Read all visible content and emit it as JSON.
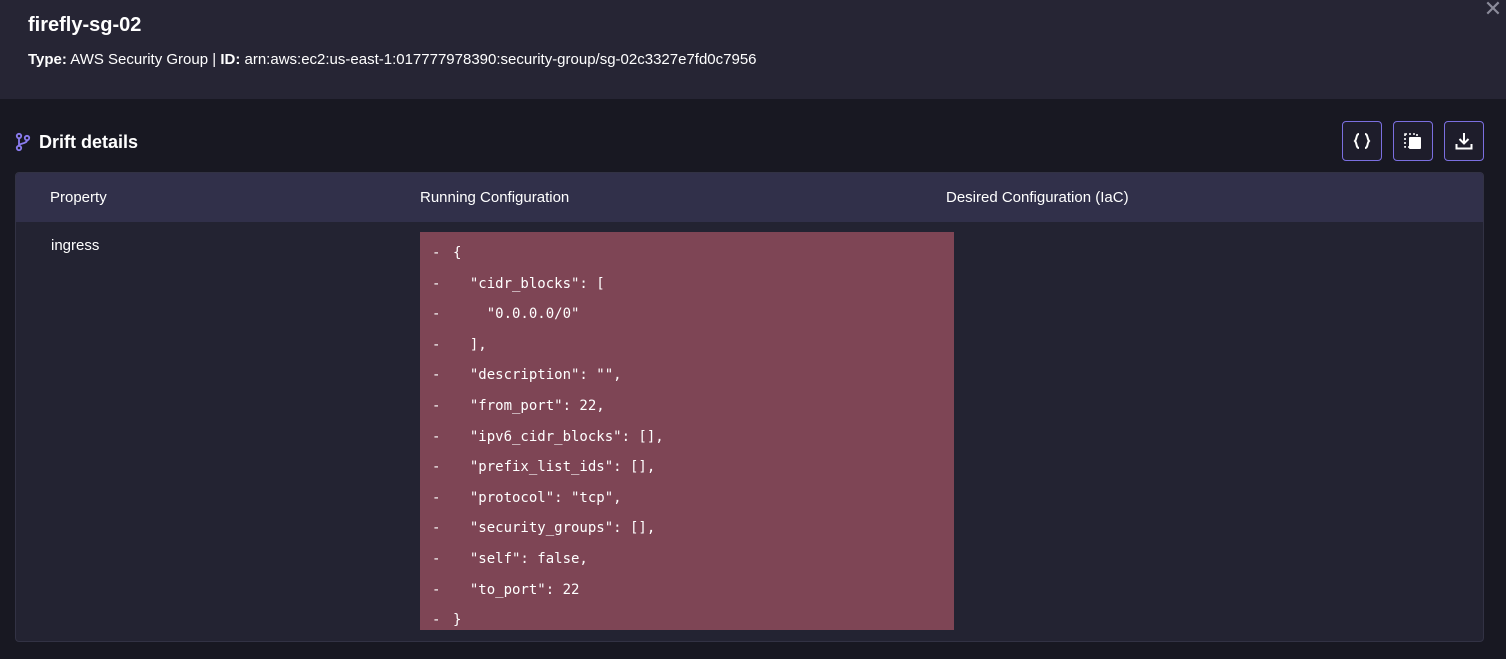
{
  "header": {
    "title": "firefly-sg-02",
    "type_label": "Type:",
    "type_value": "AWS Security Group",
    "separator": "|",
    "id_label": "ID:",
    "id_value": "arn:aws:ec2:us-east-1:017777978390:security-group/sg-02c3327e7fd0c7956",
    "close_icon": "close-icon"
  },
  "section": {
    "title": "Drift details",
    "icon": "git-branch-icon"
  },
  "toolbar": {
    "buttons": [
      {
        "icon": "code-braces-icon"
      },
      {
        "icon": "copy-icon"
      },
      {
        "icon": "download-icon"
      }
    ]
  },
  "table": {
    "columns": [
      "Property",
      "Running Configuration",
      "Desired Configuration (IaC)"
    ],
    "rows": [
      {
        "property": "ingress",
        "running": [
          {
            "marker": "-",
            "text": "{"
          },
          {
            "marker": "-",
            "text": "  \"cidr_blocks\": ["
          },
          {
            "marker": "-",
            "text": "    \"0.0.0.0/0\""
          },
          {
            "marker": "-",
            "text": "  ],"
          },
          {
            "marker": "-",
            "text": "  \"description\": \"\","
          },
          {
            "marker": "-",
            "text": "  \"from_port\": 22,"
          },
          {
            "marker": "-",
            "text": "  \"ipv6_cidr_blocks\": [],"
          },
          {
            "marker": "-",
            "text": "  \"prefix_list_ids\": [],"
          },
          {
            "marker": "-",
            "text": "  \"protocol\": \"tcp\","
          },
          {
            "marker": "-",
            "text": "  \"security_groups\": [],"
          },
          {
            "marker": "-",
            "text": "  \"self\": false,"
          },
          {
            "marker": "-",
            "text": "  \"to_port\": 22"
          },
          {
            "marker": "-",
            "text": "}"
          }
        ],
        "desired": ""
      }
    ]
  },
  "colors": {
    "header_bg": "#262534",
    "page_bg": "#181822",
    "table_bg": "#232332",
    "table_head_bg": "#31304a",
    "removed_bg": "#7e4555",
    "accent": "#7b6fe0"
  }
}
